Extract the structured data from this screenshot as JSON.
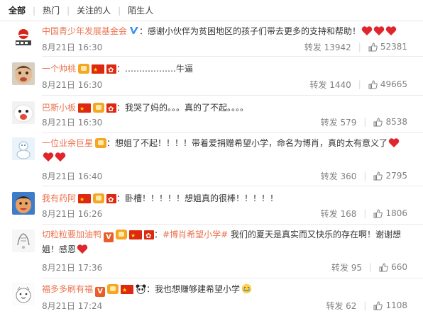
{
  "tabs": [
    {
      "label": "全部",
      "active": true
    },
    {
      "label": "热门",
      "active": false
    },
    {
      "label": "关注的人",
      "active": false
    },
    {
      "label": "陌生人",
      "active": false
    }
  ],
  "comments": [
    {
      "user": "中国青少年发展基金会",
      "text": "：感谢小伙伴为贫困地区的孩子们带去更多的支持和帮助！",
      "date": "8月21日 16:30",
      "repost": "转发 13942",
      "likes": "52381"
    },
    {
      "user": "一个帅桃",
      "text": "：………………牛逼",
      "date": "8月21日 16:30",
      "repost": "转发 1440",
      "likes": "49665"
    },
    {
      "user": "巴斯小板",
      "text": "：我哭了妈的。。。真的了不起。。。。",
      "date": "8月21日 16:30",
      "repost": "转发 579",
      "likes": "8538"
    },
    {
      "user": "一位业余巨星",
      "text": "：想姐了不起！！！！带着爱捐赠希望小学，命名为博肖，真的太有意义了",
      "date": "8月21日 16:40",
      "repost": "转发 360",
      "likes": "2795"
    },
    {
      "user": "我有药阿",
      "text": "：卧槽！！！！！想姐真的很棒！！！！！",
      "date": "8月21日 16:26",
      "repost": "转发 168",
      "likes": "1806"
    },
    {
      "user": "切粒粒要加油鸭",
      "topic": "#博肖希望小学#",
      "text": " 我们的夏天是真实而又快乐的存在啊！谢谢想姐！感恩",
      "date": "8月21日 17:36",
      "repost": "转发 95",
      "likes": "660"
    },
    {
      "user": "福多多刷有福",
      "text": "：我也想赚够建希望小学",
      "date": "8月21日 17:24",
      "repost": "转发 62",
      "likes": "1108"
    }
  ],
  "colors": {
    "username": "#eb7350",
    "heart": "#e0262c",
    "meta": "#808080",
    "verified_blue": "#3a8ee6"
  },
  "icons": [
    "heart-emoji",
    "verified-icon",
    "vip-badge-icon",
    "china-flag-icon",
    "hk-flag-icon",
    "panda-icon",
    "crying-emoji",
    "thumbs-up-icon"
  ]
}
